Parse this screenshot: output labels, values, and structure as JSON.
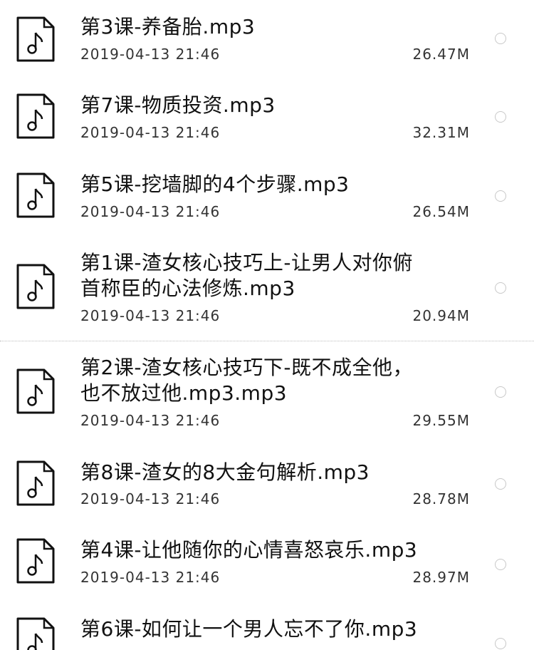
{
  "files": [
    {
      "title": "第3课-养备胎.mp3",
      "date": "2019-04-13 21:46",
      "size": "26.47M"
    },
    {
      "title": "第7课-物质投资.mp3",
      "date": "2019-04-13 21:46",
      "size": "32.31M"
    },
    {
      "title": "第5课-挖墙脚的4个步骤.mp3",
      "date": "2019-04-13 21:46",
      "size": "26.54M"
    },
    {
      "title": "第1课-渣女核心技巧上-让男人对你俯\n首称臣的心法修炼.mp3",
      "date": "2019-04-13 21:46",
      "size": "20.94M"
    },
    {
      "title": "第2课-渣女核心技巧下-既不成全他，\n也不放过他.mp3.mp3",
      "date": "2019-04-13 21:46",
      "size": "29.55M"
    },
    {
      "title": "第8课-渣女的8大金句解析.mp3",
      "date": "2019-04-13 21:46",
      "size": "28.78M"
    },
    {
      "title": "第4课-让他随你的心情喜怒哀乐.mp3",
      "date": "2019-04-13 21:46",
      "size": "28.97M"
    },
    {
      "title": "第6课-如何让一个男人忘不了你.mp3",
      "date": "",
      "size": ""
    }
  ],
  "icons": {
    "file": "audio-file-icon",
    "select": "radio-unchecked-icon"
  }
}
